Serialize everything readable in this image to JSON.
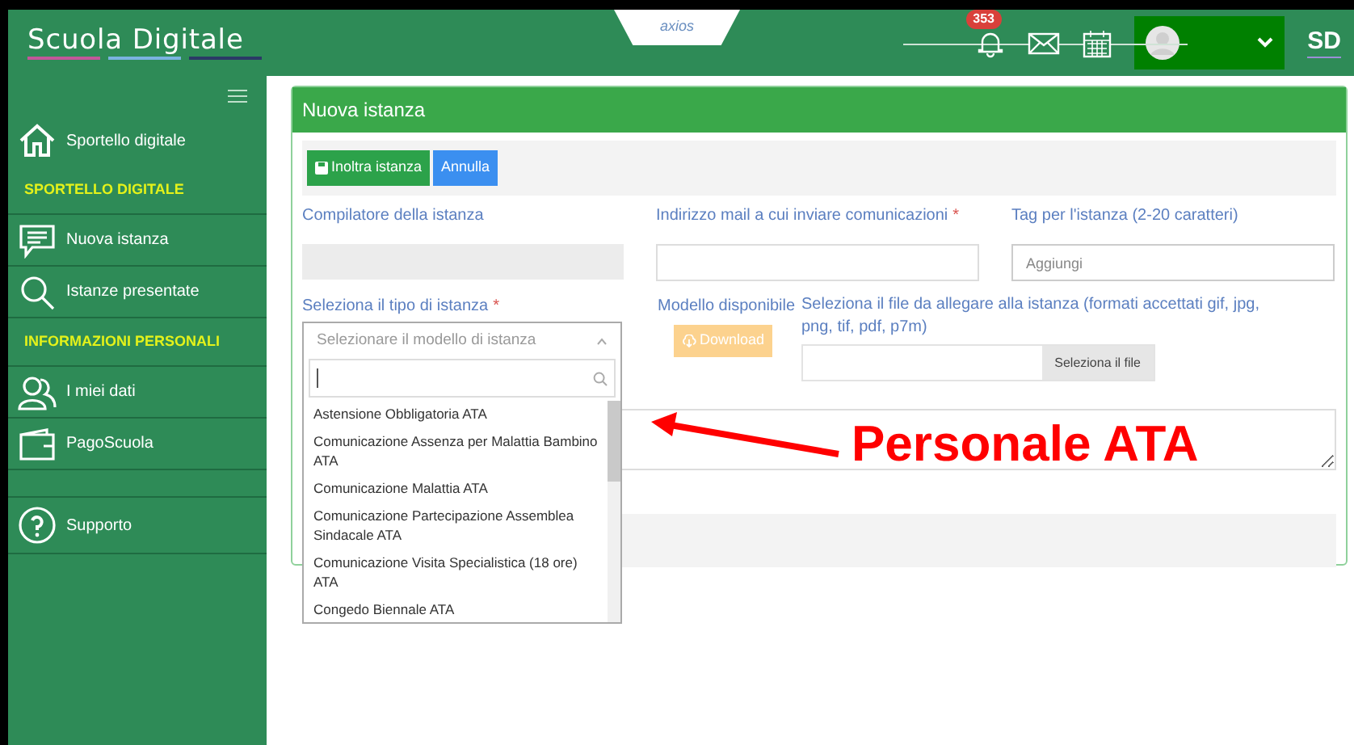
{
  "header": {
    "logo": "Scuola Digitale",
    "brand": "axios",
    "notifications_badge": "353",
    "user_initials": "SD"
  },
  "sidebar": {
    "items": [
      {
        "kind": "link",
        "label": "Sportello digitale"
      },
      {
        "kind": "section",
        "label": "SPORTELLO DIGITALE"
      },
      {
        "kind": "link",
        "label": "Nuova istanza"
      },
      {
        "kind": "link",
        "label": "Istanze presentate"
      },
      {
        "kind": "section",
        "label": "INFORMAZIONI PERSONALI"
      },
      {
        "kind": "link",
        "label": "I miei dati"
      },
      {
        "kind": "link",
        "label": "PagoScuola"
      },
      {
        "kind": "link",
        "label": "Supporto"
      }
    ]
  },
  "panel": {
    "title": "Nuova istanza",
    "buttons": [
      {
        "label": "Inoltra istanza",
        "kind": "primary"
      },
      {
        "label": "Annulla",
        "kind": "secondary"
      }
    ],
    "compiler_label": "Compilatore della istanza",
    "email_label": "Indirizzo mail a cui inviare comunicazioni",
    "email_required_mark": "*",
    "tag_label": "Tag per l'istanza (2-20 caratteri)",
    "tag_placeholder": "Aggiungi",
    "type_label": "Seleziona il tipo di istanza",
    "type_required_mark": "*",
    "type_placeholder": "Selezionare il modello di istanza",
    "model_label": "Modello disponibile",
    "download": "Download",
    "file_label": "Seleziona il file da allegare alla istanza (formati accettati gif, jpg, png, tif, pdf, p7m)",
    "file_button": "Seleziona il file",
    "dropdown_options": [
      "Astensione Obbligatoria ATA",
      "Comunicazione Assenza per Malattia Bambino ATA",
      "Comunicazione Malattia ATA",
      "Comunicazione Partecipazione Assemblea Sindacale ATA",
      "Comunicazione Visita Specialistica (18 ore) ATA",
      "Congedo Biennale ATA"
    ]
  },
  "annotation": {
    "text": "Personale ATA"
  }
}
